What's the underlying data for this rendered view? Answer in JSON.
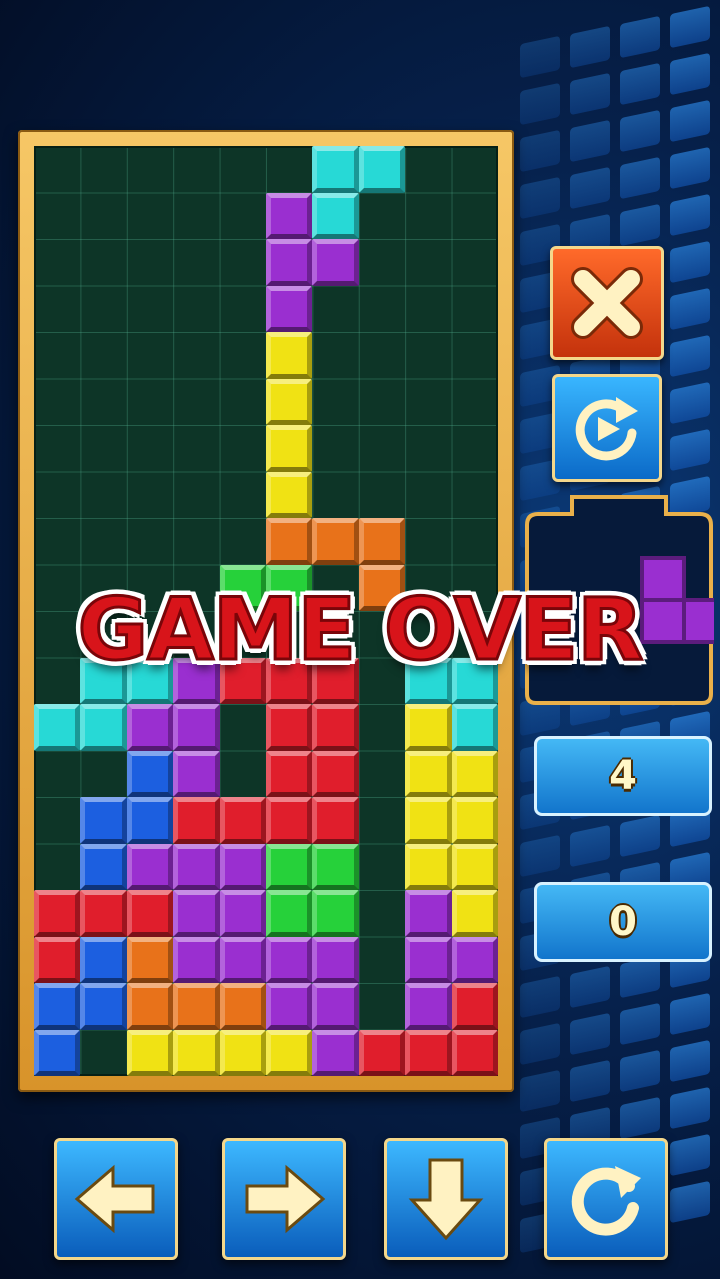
{
  "status": {
    "game_over": "GAME OVER"
  },
  "stats": {
    "lines": "4",
    "score": "0"
  },
  "colors": {
    "cyan": "#27d9d6",
    "purple": "#9a2fd0",
    "yellow": "#f0e214",
    "orange": "#e8721a",
    "green": "#26d13a",
    "red": "#e01e2c",
    "blue": "#1c5fe0",
    "frame": "#e6a83c",
    "accent_red": "#d8141a"
  },
  "board": {
    "cols": 10,
    "rows": 20,
    "cells": [
      [
        6,
        0,
        "cyan"
      ],
      [
        7,
        0,
        "cyan"
      ],
      [
        5,
        1,
        "purple"
      ],
      [
        6,
        1,
        "cyan"
      ],
      [
        5,
        2,
        "purple"
      ],
      [
        6,
        2,
        "purple"
      ],
      [
        5,
        3,
        "purple"
      ],
      [
        5,
        4,
        "yellow"
      ],
      [
        5,
        5,
        "yellow"
      ],
      [
        5,
        6,
        "yellow"
      ],
      [
        5,
        7,
        "yellow"
      ],
      [
        5,
        8,
        "orange"
      ],
      [
        6,
        8,
        "orange"
      ],
      [
        7,
        8,
        "orange"
      ],
      [
        7,
        9,
        "orange"
      ],
      [
        4,
        9,
        "green"
      ],
      [
        5,
        9,
        "green"
      ],
      [
        1,
        11,
        "cyan"
      ],
      [
        2,
        11,
        "cyan"
      ],
      [
        3,
        11,
        "purple"
      ],
      [
        4,
        11,
        "red"
      ],
      [
        5,
        11,
        "red"
      ],
      [
        6,
        11,
        "red"
      ],
      [
        8,
        11,
        "cyan"
      ],
      [
        9,
        11,
        "cyan"
      ],
      [
        0,
        12,
        "cyan"
      ],
      [
        1,
        12,
        "cyan"
      ],
      [
        2,
        12,
        "purple"
      ],
      [
        3,
        12,
        "purple"
      ],
      [
        5,
        12,
        "red"
      ],
      [
        6,
        12,
        "red"
      ],
      [
        8,
        12,
        "yellow"
      ],
      [
        9,
        12,
        "cyan"
      ],
      [
        2,
        13,
        "blue"
      ],
      [
        3,
        13,
        "purple"
      ],
      [
        5,
        13,
        "red"
      ],
      [
        6,
        13,
        "red"
      ],
      [
        8,
        13,
        "yellow"
      ],
      [
        9,
        13,
        "yellow"
      ],
      [
        1,
        14,
        "blue"
      ],
      [
        2,
        14,
        "blue"
      ],
      [
        3,
        14,
        "red"
      ],
      [
        4,
        14,
        "red"
      ],
      [
        5,
        14,
        "red"
      ],
      [
        6,
        14,
        "red"
      ],
      [
        8,
        14,
        "yellow"
      ],
      [
        9,
        14,
        "yellow"
      ],
      [
        1,
        15,
        "blue"
      ],
      [
        2,
        15,
        "purple"
      ],
      [
        3,
        15,
        "purple"
      ],
      [
        4,
        15,
        "purple"
      ],
      [
        5,
        15,
        "green"
      ],
      [
        6,
        15,
        "green"
      ],
      [
        8,
        15,
        "yellow"
      ],
      [
        9,
        15,
        "yellow"
      ],
      [
        0,
        16,
        "red"
      ],
      [
        1,
        16,
        "red"
      ],
      [
        2,
        16,
        "red"
      ],
      [
        3,
        16,
        "purple"
      ],
      [
        4,
        16,
        "purple"
      ],
      [
        5,
        16,
        "green"
      ],
      [
        6,
        16,
        "green"
      ],
      [
        8,
        16,
        "purple"
      ],
      [
        9,
        16,
        "yellow"
      ],
      [
        0,
        17,
        "red"
      ],
      [
        1,
        17,
        "blue"
      ],
      [
        2,
        17,
        "orange"
      ],
      [
        3,
        17,
        "purple"
      ],
      [
        4,
        17,
        "purple"
      ],
      [
        5,
        17,
        "purple"
      ],
      [
        6,
        17,
        "purple"
      ],
      [
        8,
        17,
        "purple"
      ],
      [
        9,
        17,
        "purple"
      ],
      [
        0,
        18,
        "blue"
      ],
      [
        1,
        18,
        "blue"
      ],
      [
        2,
        18,
        "orange"
      ],
      [
        3,
        18,
        "orange"
      ],
      [
        4,
        18,
        "orange"
      ],
      [
        5,
        18,
        "purple"
      ],
      [
        6,
        18,
        "purple"
      ],
      [
        8,
        18,
        "purple"
      ],
      [
        9,
        18,
        "red"
      ],
      [
        0,
        19,
        "blue"
      ],
      [
        2,
        19,
        "yellow"
      ],
      [
        3,
        19,
        "yellow"
      ],
      [
        4,
        19,
        "yellow"
      ],
      [
        5,
        19,
        "yellow"
      ],
      [
        6,
        19,
        "purple"
      ],
      [
        7,
        19,
        "red"
      ],
      [
        8,
        19,
        "red"
      ],
      [
        9,
        19,
        "red"
      ]
    ]
  },
  "next_piece": {
    "color": "purple",
    "cells": [
      [
        1,
        0
      ],
      [
        1,
        1
      ],
      [
        2,
        1
      ]
    ]
  },
  "icons": {
    "close": "close-icon",
    "restart": "restart-icon",
    "left": "arrow-left-icon",
    "right": "arrow-right-icon",
    "down": "arrow-down-icon",
    "rotate": "rotate-icon"
  }
}
